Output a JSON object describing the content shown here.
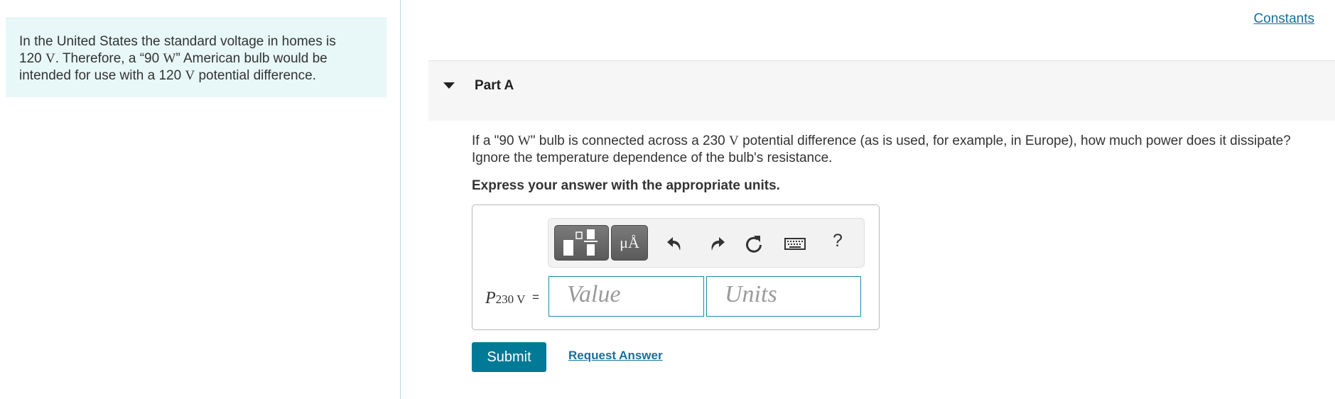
{
  "intro": {
    "line1": "In the United States the standard voltage in homes is",
    "l2_num": "120",
    "l2_unit": "V",
    "l2_mid": ". Therefore, a “90",
    "l2_unit2": "W",
    "l2_end": "” American bulb would be",
    "l3_start": "intended for use with a 120",
    "l3_unit": "V",
    "l3_end": "potential difference."
  },
  "constants_link": "Constants",
  "part": {
    "title": "Part A",
    "q1_a": "If a \"90",
    "q1_unit": "W",
    "q1_b": "\" bulb is connected across a 230",
    "q1_unit2": "V",
    "q1_c": "potential difference (as is used, for example, in Europe), how much power does it dissipate?",
    "q2": "Ignore the temperature dependence of the bulb's resistance.",
    "instruction": "Express your answer with the appropriate units."
  },
  "toolbar": {
    "icons": [
      "templates-icon",
      "units-icon",
      "undo-icon",
      "redo-icon",
      "reset-icon",
      "keyboard-icon",
      "help-icon"
    ],
    "units_label": "μÅ",
    "help_label": "?"
  },
  "answer": {
    "var_symbol": "P",
    "var_sub": "230 V",
    "equals": "=",
    "value_placeholder": "Value",
    "units_placeholder": "Units"
  },
  "buttons": {
    "submit": "Submit",
    "request_answer": "Request Answer"
  },
  "colors": {
    "accent": "#007a96",
    "link": "#1a6f99",
    "intro_bg": "#e8f7f7"
  }
}
